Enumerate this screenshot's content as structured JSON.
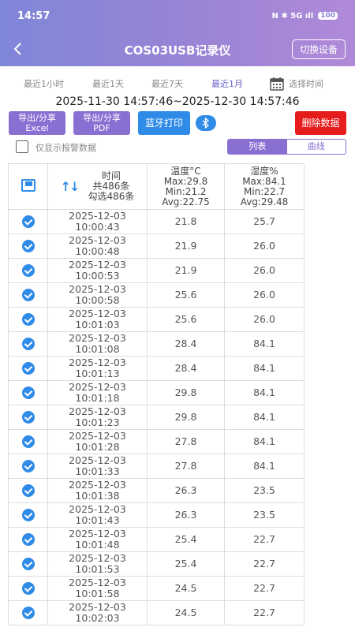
{
  "status": {
    "time": "14:57",
    "icons": "N  ✱  5G ıll",
    "battery": "100"
  },
  "nav": {
    "title": "COS03USB记录仪",
    "switch_label": "切换设备"
  },
  "range_tabs": [
    {
      "label": "最近1小时"
    },
    {
      "label": "最近1天"
    },
    {
      "label": "最近7天"
    },
    {
      "label": "最近1月"
    }
  ],
  "pick_time_label": "选择时间",
  "date_range": "2025-11-30 14:57:46~2025-12-30 14:57:46",
  "actions": {
    "export_excel_line1": "导出/分享",
    "export_excel_line2": "Excel",
    "export_pdf_line1": "导出/分享",
    "export_pdf_line2": "PDF",
    "bt_print": "蓝牙打印",
    "delete": "删除数据"
  },
  "filter": {
    "alarm_only": "仅显示报警数据",
    "view_list": "列表",
    "view_curve": "曲线"
  },
  "table": {
    "header": {
      "time": "时间",
      "total": "共486条",
      "selected": "勾选486条",
      "temp_title": "温度°C",
      "temp_max": "Max:29.8",
      "temp_min": "Min:21.2",
      "temp_avg": "Avg:22.75",
      "hum_title": "湿度%",
      "hum_max": "Max:84.1",
      "hum_min": "Min:22.7",
      "hum_avg": "Avg:29.48"
    },
    "rows": [
      {
        "date": "2025-12-03",
        "time": "10:00:43",
        "temp": "21.8",
        "hum": "25.7"
      },
      {
        "date": "2025-12-03",
        "time": "10:00:48",
        "temp": "21.9",
        "hum": "26.0"
      },
      {
        "date": "2025-12-03",
        "time": "10:00:53",
        "temp": "21.9",
        "hum": "26.0"
      },
      {
        "date": "2025-12-03",
        "time": "10:00:58",
        "temp": "25.6",
        "hum": "26.0"
      },
      {
        "date": "2025-12-03",
        "time": "10:01:03",
        "temp": "25.6",
        "hum": "26.0"
      },
      {
        "date": "2025-12-03",
        "time": "10:01:08",
        "temp": "28.4",
        "hum": "84.1"
      },
      {
        "date": "2025-12-03",
        "time": "10:01:13",
        "temp": "28.4",
        "hum": "84.1"
      },
      {
        "date": "2025-12-03",
        "time": "10:01:18",
        "temp": "29.8",
        "hum": "84.1"
      },
      {
        "date": "2025-12-03",
        "time": "10:01:23",
        "temp": "29.8",
        "hum": "84.1"
      },
      {
        "date": "2025-12-03",
        "time": "10:01:28",
        "temp": "27.8",
        "hum": "84.1"
      },
      {
        "date": "2025-12-03",
        "time": "10:01:33",
        "temp": "27.8",
        "hum": "84.1"
      },
      {
        "date": "2025-12-03",
        "time": "10:01:38",
        "temp": "26.3",
        "hum": "23.5"
      },
      {
        "date": "2025-12-03",
        "time": "10:01:43",
        "temp": "26.3",
        "hum": "23.5"
      },
      {
        "date": "2025-12-03",
        "time": "10:01:48",
        "temp": "25.4",
        "hum": "22.7"
      },
      {
        "date": "2025-12-03",
        "time": "10:01:53",
        "temp": "25.4",
        "hum": "22.7"
      },
      {
        "date": "2025-12-03",
        "time": "10:01:58",
        "temp": "24.5",
        "hum": "22.7"
      },
      {
        "date": "2025-12-03",
        "time": "10:02:03",
        "temp": "24.5",
        "hum": "22.7"
      }
    ]
  },
  "colors": {
    "accent_purple": "#8a6fd3",
    "accent_blue": "#2f8be8",
    "danger_red": "#e61b1b"
  }
}
